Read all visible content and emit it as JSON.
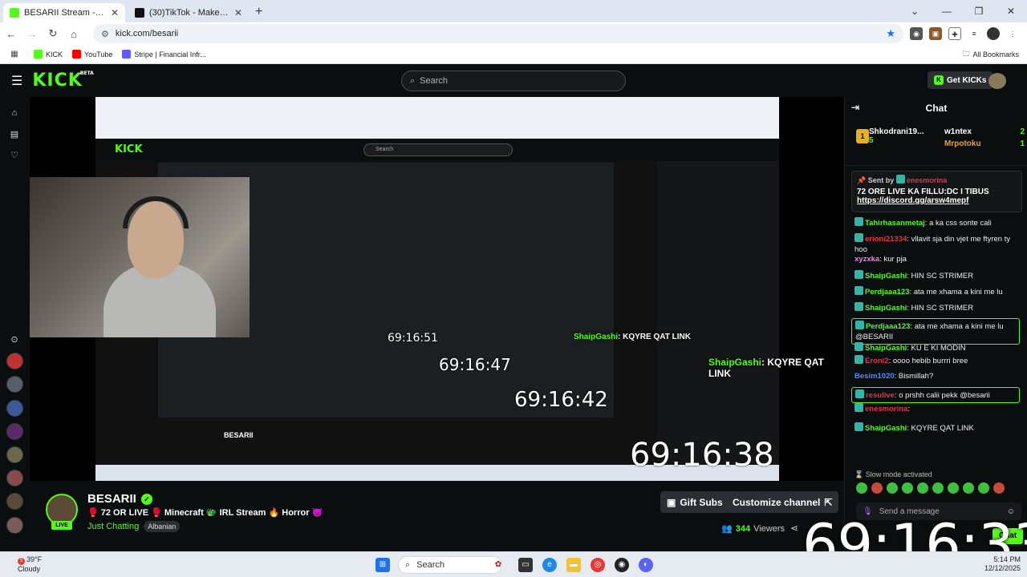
{
  "browser": {
    "tabs": [
      {
        "title": "BESARII Stream - Watch Live on",
        "active": true,
        "color": "#53fc18"
      },
      {
        "title": "(30)TikTok - Make Your Day",
        "active": false,
        "color": "#111111"
      }
    ],
    "new_tab": "+",
    "url": "kick.com/besarii",
    "bookmarks": [
      {
        "label": "KICK",
        "color": "#53fc18"
      },
      {
        "label": "YouTube",
        "color": "#ff0000"
      },
      {
        "label": "Stripe | Financial Infr...",
        "color": "#635bff"
      }
    ],
    "all_bookmarks": "All Bookmarks"
  },
  "kick": {
    "logo": "KICK",
    "beta": "BETA",
    "search_placeholder": "Search",
    "get_kicks": "Get KICKs"
  },
  "video": {
    "timestamps": [
      "69:16:51",
      "69:16:47",
      "69:16:42",
      "69:16:38"
    ],
    "chat_overlay": [
      {
        "user": "ShaipGashi",
        "text": ": KQYRE QAT LINK"
      },
      {
        "user": "ShaipGashi",
        "text": ": KQYRE QAT LINK"
      }
    ],
    "mini_streamer": "BESARII"
  },
  "stream": {
    "name": "BESARII",
    "live": "LIVE",
    "title": "🥊 72 OR LIVE 🥊 Minecraft 🐲 IRL Stream 🔥 Horror 👿",
    "category": "Just Chatting",
    "tag": "Albanian",
    "gift_subs": "Gift Subs",
    "customize_channel": "Customize channel",
    "viewers_count": "344",
    "viewers_label": "Viewers",
    "big_timestamp": "69:16:33"
  },
  "chat": {
    "header": "Chat",
    "leaderboard": {
      "top": {
        "name": "Shkodrani19...",
        "count": "5"
      },
      "others": [
        {
          "name": "w1ntex",
          "count": "2"
        },
        {
          "name": "Mrpotoku",
          "count": "1"
        }
      ]
    },
    "pinned": {
      "sent_by_label": "Sent by",
      "sender": "enesmorina",
      "message": "72 ORE LIVE KA FILLU:DC I TIBUS",
      "link": "https://discord.gg/arsw4mepf"
    },
    "messages": [
      {
        "user": "Tahirhasanmetaj",
        "text": ": a ka css sonte cali",
        "color": "#53fc18"
      },
      {
        "user": "erioni21334",
        "text": ": vllavit sja din vjet me ftyren ty hoo",
        "color": "#e0344a"
      },
      {
        "user": "xyzxka",
        "text": ": kur pja",
        "color": "#e88ae0"
      },
      {
        "user": "ShaipGashi",
        "text": ": HIN SC STRIMER",
        "color": "#53fc18"
      },
      {
        "user": "Perdjaaa123",
        "text": ": ata me xhama a kini me lu",
        "color": "#53fc18"
      },
      {
        "user": "ShaipGashi",
        "text": ": HIN SC STRIMER",
        "color": "#53fc18"
      },
      {
        "user": "Perdjaaa123",
        "text": ": ata me xhama a kini me lu @BESARII",
        "color": "#53fc18"
      },
      {
        "user": "ShaipGashi",
        "text": ": KU E KI MODIN",
        "color": "#53fc18"
      },
      {
        "user": "Eroni2",
        "text": ": oooo hebib burrri bree",
        "color": "#e0344a"
      },
      {
        "user": "Besim1020",
        "text": ": Bismillah?",
        "color": "#4a8cff"
      },
      {
        "user": "resulive",
        "text": ": o prshh calii pekk @besarii",
        "color": "#e0344a"
      },
      {
        "user": "enesmorina",
        "text": ":",
        "color": "#e0344a"
      },
      {
        "user": "ShaipGashi",
        "text": ": KQYRE QAT LINK",
        "color": "#53fc18"
      }
    ],
    "slow_mode": "Slow mode activated",
    "send_placeholder": "Send a message",
    "chat_button": "Chat"
  },
  "taskbar": {
    "temp": "39°F",
    "weather": "Cloudy",
    "search": "Search",
    "time": "5:14 PM",
    "date": "12/12/2025"
  }
}
